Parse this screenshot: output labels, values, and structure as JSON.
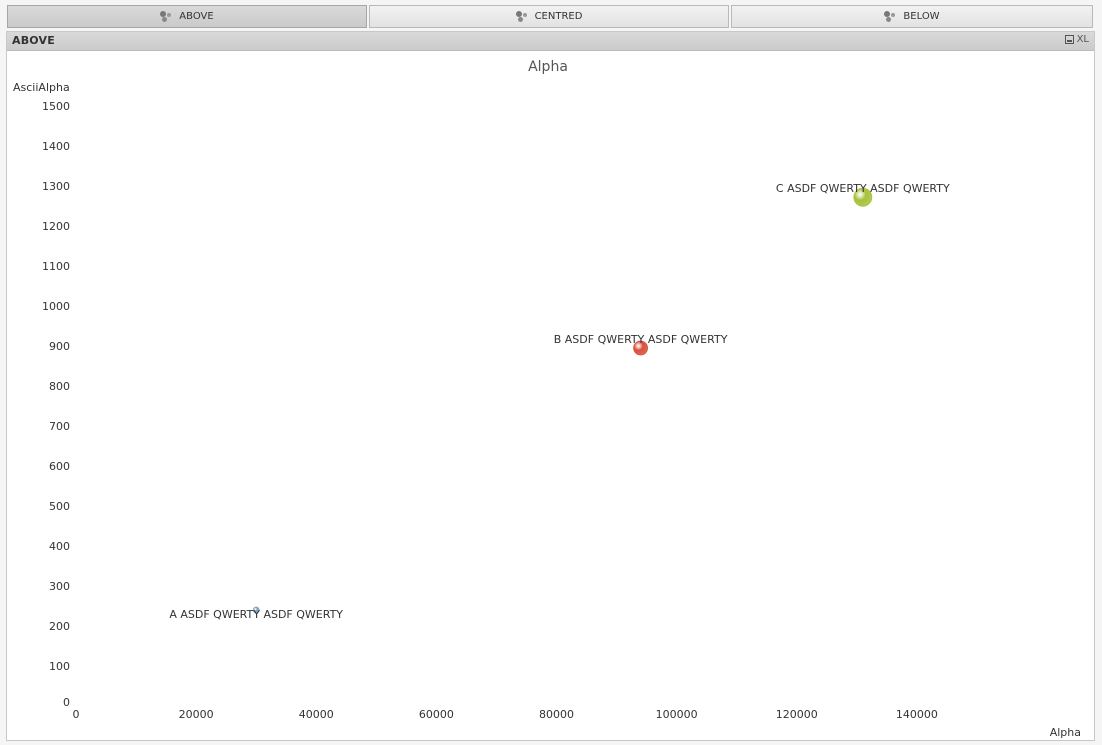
{
  "tabs": [
    {
      "label": "ABOVE",
      "active": true
    },
    {
      "label": "CENTRED",
      "active": false
    },
    {
      "label": "BELOW",
      "active": false
    }
  ],
  "panel": {
    "title": "ABOVE",
    "xl_label": "XL"
  },
  "chart_data": {
    "type": "scatter",
    "title": "Alpha",
    "xlabel": "Alpha",
    "ylabel": "AsciiAlpha",
    "xlim": [
      0,
      160000
    ],
    "ylim": [
      0,
      1500
    ],
    "x_ticks": [
      0,
      20000,
      40000,
      60000,
      80000,
      100000,
      120000,
      140000
    ],
    "y_ticks": [
      0,
      100,
      200,
      300,
      400,
      500,
      600,
      700,
      800,
      900,
      1000,
      1100,
      1200,
      1300,
      1400,
      1500
    ],
    "grid": false,
    "points": [
      {
        "label": "A ASDF QWERTY ASDF QWERTY",
        "x": 30000,
        "y": 240,
        "size": 3,
        "color": "#7f9fc2"
      },
      {
        "label": "B ASDF QWERTY ASDF QWERTY",
        "x": 94000,
        "y": 895,
        "size": 7,
        "color": "#d9503c"
      },
      {
        "label": "C ASDF QWERTY ASDF QWERTY",
        "x": 131000,
        "y": 1272,
        "size": 9,
        "color": "#a6c23a"
      }
    ]
  }
}
